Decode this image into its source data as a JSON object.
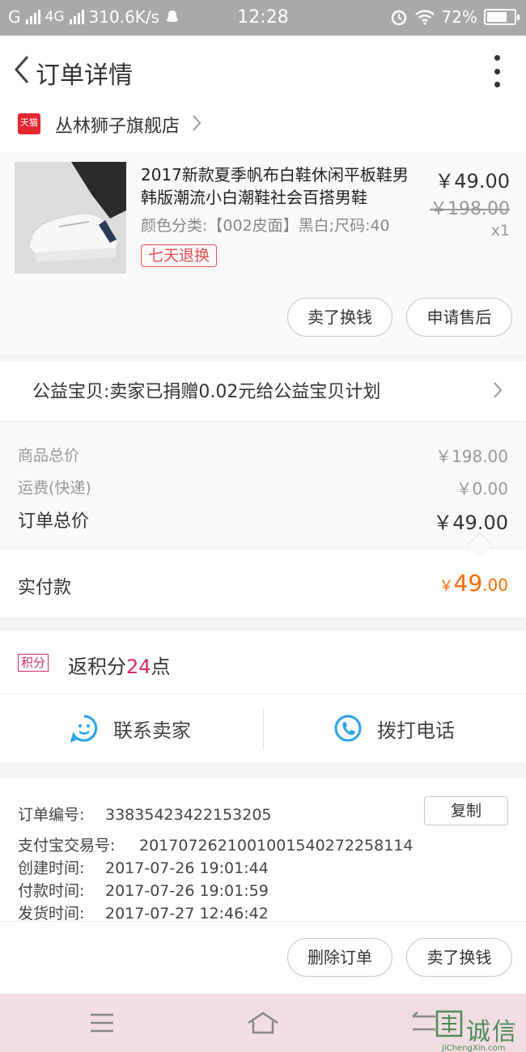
{
  "status_bar": {
    "carrier": "G",
    "network": "4G",
    "speed": "310.6K/s",
    "time": "12:28",
    "battery": "72%"
  },
  "header": {
    "title": "订单详情"
  },
  "shop": {
    "badge": "天猫",
    "name": "丛林狮子旗舰店"
  },
  "product": {
    "title": "2017新款夏季帆布白鞋休闲平板鞋男韩版潮流小白潮鞋社会百搭男鞋",
    "sku": "颜色分类:【002皮面】黑白;尺码:40",
    "tag": "七天退换",
    "price": "￥49.00",
    "original_price": "￥198.00",
    "quantity": "x1",
    "btn_sell": "卖了换钱",
    "btn_after_sale": "申请售后"
  },
  "charity": {
    "text": "公益宝贝:卖家已捐赠0.02元给公益宝贝计划"
  },
  "summary": {
    "goods_label": "商品总价",
    "goods_value": "￥198.00",
    "shipping_label": "运费(快递)",
    "shipping_value": "￥0.00",
    "order_label": "订单总价",
    "order_value": "￥49.00",
    "paid_label": "实付款",
    "paid_symbol": "￥",
    "paid_int": "49",
    "paid_dec": ".00"
  },
  "points": {
    "badge": "积分",
    "prefix": "返积分",
    "count": "24",
    "suffix": "点"
  },
  "contact": {
    "seller": "联系卖家",
    "phone": "拨打电话"
  },
  "info": {
    "order_no_label": "订单编号:",
    "order_no": "33835423422153205",
    "copy": "复制",
    "alipay_label": "支付宝交易号:",
    "alipay_no": "2017072621001001540272258114",
    "created_label": "创建时间:",
    "created": "2017-07-26 19:01:44",
    "paid_label": "付款时间:",
    "paid": "2017-07-26 19:01:59",
    "shipped_label": "发货时间:",
    "shipped": "2017-07-27 12:46:42"
  },
  "actions": {
    "delete": "删除订单",
    "sell": "卖了换钱"
  },
  "watermark": {
    "text": "诚信",
    "domain": "JiChengXin.com"
  },
  "colors": {
    "accent_orange": "#ff6a00",
    "tmall_red": "#e4262f",
    "points_pink": "#d52c6b",
    "icon_blue": "#2aa3e6"
  }
}
